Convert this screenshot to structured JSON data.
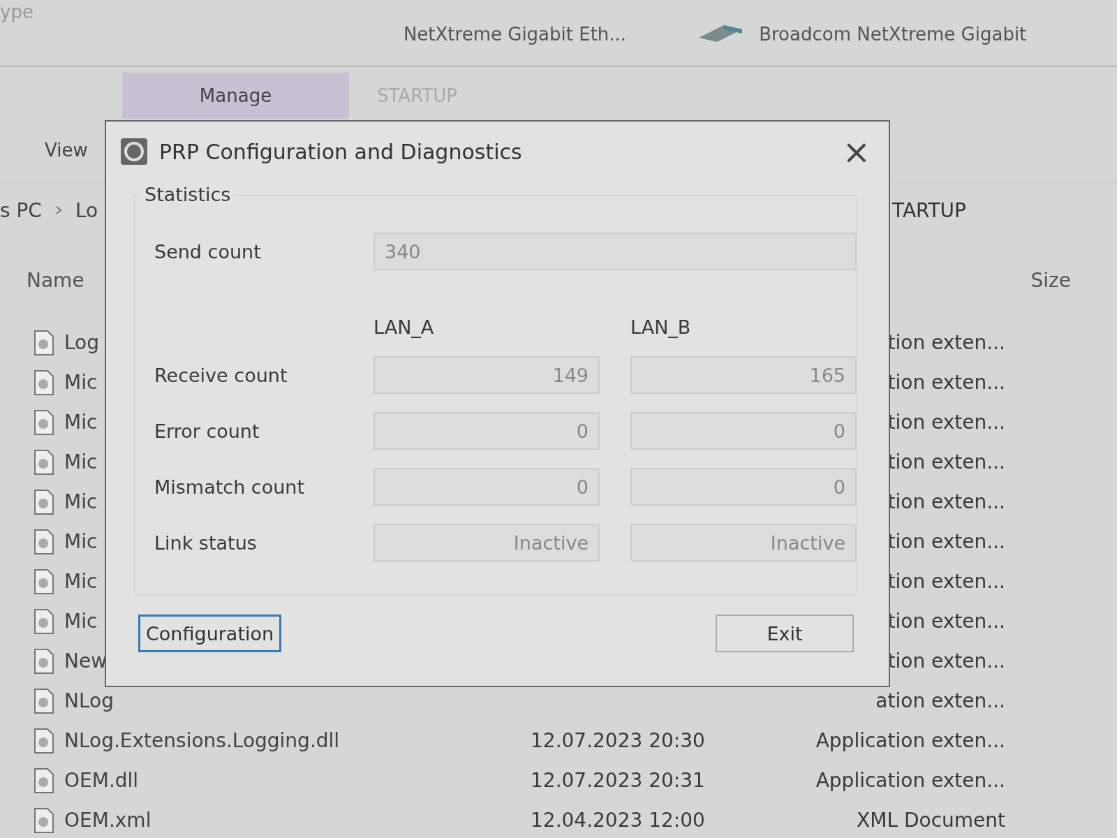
{
  "explorer": {
    "top_strip": [
      "ype",
      "NetXtreme Gigabit Eth...",
      "Broadcom NetXtreme Gigabit"
    ],
    "ribbon_tabs": [
      {
        "label": "Manage",
        "selected": true
      },
      {
        "label": "STARTUP",
        "selected": false
      }
    ],
    "view_menu": "View",
    "breadcrumb": [
      "s PC",
      "Lo"
    ],
    "right_tab": "TARTUP",
    "columns": [
      "Name",
      "Size"
    ],
    "rows": [
      {
        "name": "Log",
        "date": "",
        "type": "tion exten..."
      },
      {
        "name": "Mic",
        "date": "",
        "type": "tion exten..."
      },
      {
        "name": "Mic",
        "date": "",
        "type": "tion exten..."
      },
      {
        "name": "Mic",
        "date": "",
        "type": "tion exten..."
      },
      {
        "name": "Mic",
        "date": "",
        "type": "tion exten..."
      },
      {
        "name": "Mic",
        "date": "",
        "type": "tion exten..."
      },
      {
        "name": "Mic",
        "date": "",
        "type": "tion exten..."
      },
      {
        "name": "Mic",
        "date": "",
        "type": "tion exten..."
      },
      {
        "name": "New",
        "date": "",
        "type": "tion exten..."
      },
      {
        "name": "NLog",
        "date": "",
        "type": "ation exten..."
      },
      {
        "name": "NLog.Extensions.Logging.dll",
        "date": "12.07.2023 20:30",
        "type": "Application exten..."
      },
      {
        "name": "OEM.dll",
        "date": "12.07.2023 20:31",
        "type": "Application exten..."
      },
      {
        "name": "OEM.xml",
        "date": "12.04.2023 12:00",
        "type": "XML Document"
      }
    ]
  },
  "dialog": {
    "title": "PRP Configuration and Diagnostics",
    "close": "×",
    "group": "Statistics",
    "send_count": {
      "label": "Send count",
      "value": "340"
    },
    "lanes": [
      "LAN_A",
      "LAN_B"
    ],
    "rows": [
      {
        "label": "Receive count",
        "values": [
          "149",
          "165"
        ]
      },
      {
        "label": "Error count",
        "values": [
          "0",
          "0"
        ]
      },
      {
        "label": "Mismatch count",
        "values": [
          "0",
          "0"
        ]
      },
      {
        "label": "Link status",
        "values": [
          "Inactive",
          "Inactive"
        ]
      }
    ],
    "buttons": [
      {
        "label": "Configuration",
        "focused": true
      },
      {
        "label": "Exit",
        "focused": false
      }
    ]
  }
}
